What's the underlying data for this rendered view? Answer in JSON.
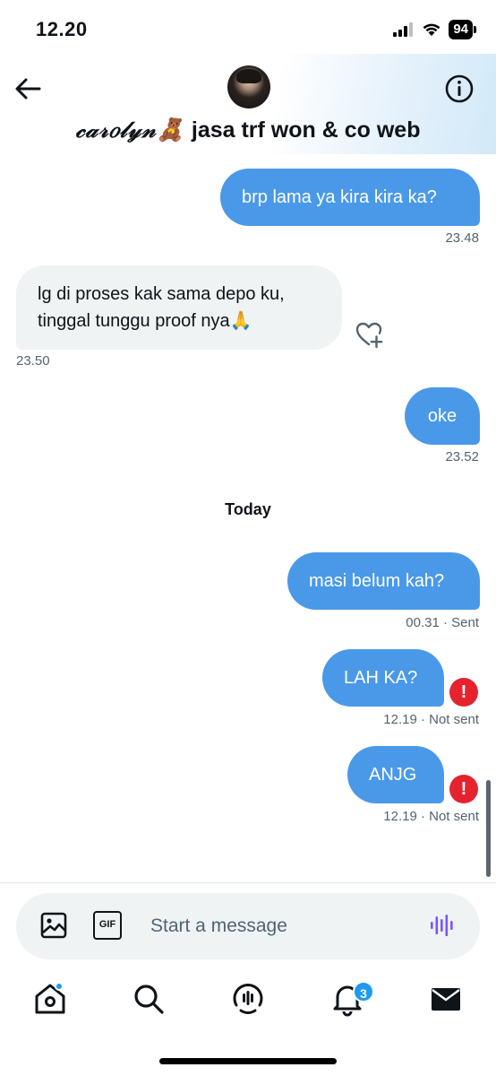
{
  "status_bar": {
    "time": "12.20",
    "battery": "94",
    "icons": [
      "signal-icon",
      "wifi-icon",
      "battery-icon"
    ]
  },
  "header": {
    "contact_name_script": "𝒸𝒶𝓇𝑜𝓁𝓎𝓃🧸",
    "contact_name_text": " jasa trf won & co web",
    "icons": [
      "back-arrow-icon",
      "info-icon"
    ]
  },
  "messages": [
    {
      "direction": "out",
      "text": "brp lama ya kira kira ka?",
      "meta": "23.48"
    },
    {
      "direction": "in",
      "text_line1": "lg di proses kak sama depo ku,",
      "text_line2": "tinggal tunggu proof nya🙏",
      "meta": "23.50"
    },
    {
      "direction": "out",
      "text": "oke",
      "meta": "23.52"
    },
    {
      "direction": "out",
      "text": "masi belum kah?",
      "meta": "00.31 · Sent"
    },
    {
      "direction": "out",
      "text": "LAH KA?",
      "meta": "12.19 · Not sent",
      "error": true
    },
    {
      "direction": "out",
      "text": "ANJG",
      "meta": "12.19 · Not sent",
      "error": true
    }
  ],
  "day_separator": "Today",
  "error_glyph": "!",
  "composer": {
    "placeholder": "Start a message",
    "gif_label": "GIF",
    "icons": [
      "image-icon",
      "gif-icon",
      "voice-icon"
    ]
  },
  "tabbar": {
    "items": [
      "home",
      "search",
      "spaces",
      "notifications",
      "messages"
    ],
    "notifications_badge": "3"
  },
  "colors": {
    "outgoing_bubble": "#4a99e9",
    "incoming_bubble": "#eff3f4",
    "error": "#e5232f",
    "accent": "#1d9bf0",
    "voice_icon": "#7856ff"
  }
}
